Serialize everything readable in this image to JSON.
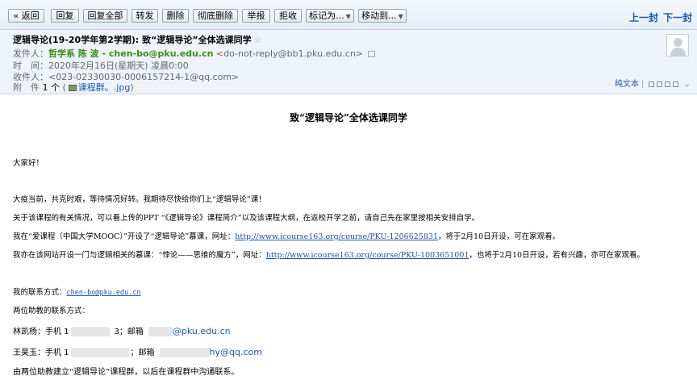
{
  "toolbar": {
    "back": "« 返回",
    "reply": "回复",
    "reply_all": "回复全部",
    "forward": "转发",
    "delete": "删除",
    "delete_perm": "彻底删除",
    "report": "举报",
    "reject": "拒收",
    "mark_as": "标记为...",
    "move_to": "移动到...",
    "prev": "上一封",
    "next": "下一封"
  },
  "header": {
    "subject": "逻辑导论(19-20学年第2学期): 致“逻辑导论”全体选课同学",
    "star": "☆",
    "from_label": "发件人：",
    "from_name": "哲学系 陈 波 - chen-bo@pku.edu.cn",
    "from_addr": "<do-not-reply@bb1.pku.edu.cn>",
    "time_label": "时　间：",
    "time_value": "2020年2月16日(星期天) 凌晨0:00",
    "to_label": "收件人：",
    "to_value": "<023-02330030-0006157214-1@qq.com>",
    "att_label": "附　件",
    "att_count": "1 个",
    "att_name": "课程群。.jpg",
    "plain_text": "纯文本"
  },
  "body": {
    "title": "致“逻辑导论”全体选课同学",
    "greeting": "大家好！",
    "p1": "大疫当前，共克时艰，等待情况好转。我期待尽快给你们上“逻辑导论”课！",
    "p2": "关于该课程的有关情况，可以看上传的PPT “《逻辑导论》课程简介”以及该课程大纲，在返校开学之前，请自己先在家里按相关安排自学。",
    "p3_a": "我在“爱课程（中国大学MOOC）”开设了“逻辑导论”慕课，网址：",
    "p3_link": "http://www.icourse163.org/course/PKU-1206625831",
    "p3_b": "，将于2月10日开设，可在家观看。",
    "p4_a": "我亦在该网站开设一门与逻辑相关的慕课：“悖论——思维的魔方”，网址：",
    "p4_link": "http://www.icourse163.org/course/PKU-1003651001",
    "p4_b": "，也将于2月10日开设，若有兴趣，亦可在家观看。",
    "contact_label": "我的联系方式：",
    "contact_email": "chen-bo@pku.edu.cn",
    "ta_label": "两位助教的联系方式：",
    "ta1_a": "林凯杨：手机 1",
    "ta1_b": "3；邮箱",
    "ta1_email": "@pku.edu.cn",
    "ta2_a": "王昊玉：手机 1",
    "ta2_b": "；邮箱",
    "ta2_email": "hy@qq.com",
    "last": "由两位助教建立“逻辑导论”课程群，以后在课程群中沟通联系。"
  }
}
